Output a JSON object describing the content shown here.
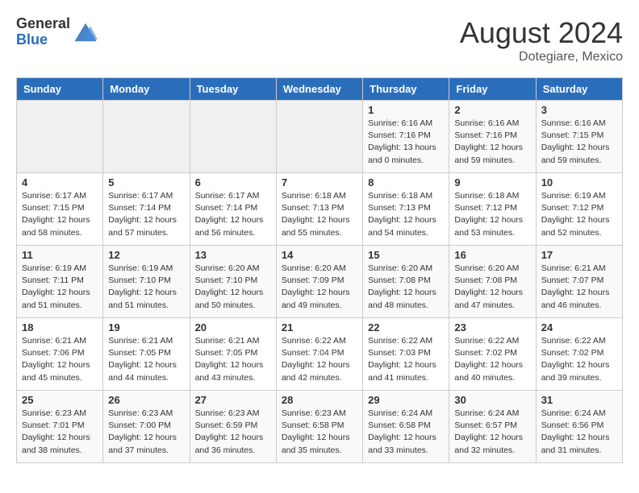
{
  "header": {
    "logo_general": "General",
    "logo_blue": "Blue",
    "month_title": "August 2024",
    "location": "Dotegiare, Mexico"
  },
  "days_of_week": [
    "Sunday",
    "Monday",
    "Tuesday",
    "Wednesday",
    "Thursday",
    "Friday",
    "Saturday"
  ],
  "weeks": [
    [
      {
        "day": "",
        "info": ""
      },
      {
        "day": "",
        "info": ""
      },
      {
        "day": "",
        "info": ""
      },
      {
        "day": "",
        "info": ""
      },
      {
        "day": "1",
        "info": "Sunrise: 6:16 AM\nSunset: 7:16 PM\nDaylight: 13 hours\nand 0 minutes."
      },
      {
        "day": "2",
        "info": "Sunrise: 6:16 AM\nSunset: 7:16 PM\nDaylight: 12 hours\nand 59 minutes."
      },
      {
        "day": "3",
        "info": "Sunrise: 6:16 AM\nSunset: 7:15 PM\nDaylight: 12 hours\nand 59 minutes."
      }
    ],
    [
      {
        "day": "4",
        "info": "Sunrise: 6:17 AM\nSunset: 7:15 PM\nDaylight: 12 hours\nand 58 minutes."
      },
      {
        "day": "5",
        "info": "Sunrise: 6:17 AM\nSunset: 7:14 PM\nDaylight: 12 hours\nand 57 minutes."
      },
      {
        "day": "6",
        "info": "Sunrise: 6:17 AM\nSunset: 7:14 PM\nDaylight: 12 hours\nand 56 minutes."
      },
      {
        "day": "7",
        "info": "Sunrise: 6:18 AM\nSunset: 7:13 PM\nDaylight: 12 hours\nand 55 minutes."
      },
      {
        "day": "8",
        "info": "Sunrise: 6:18 AM\nSunset: 7:13 PM\nDaylight: 12 hours\nand 54 minutes."
      },
      {
        "day": "9",
        "info": "Sunrise: 6:18 AM\nSunset: 7:12 PM\nDaylight: 12 hours\nand 53 minutes."
      },
      {
        "day": "10",
        "info": "Sunrise: 6:19 AM\nSunset: 7:12 PM\nDaylight: 12 hours\nand 52 minutes."
      }
    ],
    [
      {
        "day": "11",
        "info": "Sunrise: 6:19 AM\nSunset: 7:11 PM\nDaylight: 12 hours\nand 51 minutes."
      },
      {
        "day": "12",
        "info": "Sunrise: 6:19 AM\nSunset: 7:10 PM\nDaylight: 12 hours\nand 51 minutes."
      },
      {
        "day": "13",
        "info": "Sunrise: 6:20 AM\nSunset: 7:10 PM\nDaylight: 12 hours\nand 50 minutes."
      },
      {
        "day": "14",
        "info": "Sunrise: 6:20 AM\nSunset: 7:09 PM\nDaylight: 12 hours\nand 49 minutes."
      },
      {
        "day": "15",
        "info": "Sunrise: 6:20 AM\nSunset: 7:08 PM\nDaylight: 12 hours\nand 48 minutes."
      },
      {
        "day": "16",
        "info": "Sunrise: 6:20 AM\nSunset: 7:08 PM\nDaylight: 12 hours\nand 47 minutes."
      },
      {
        "day": "17",
        "info": "Sunrise: 6:21 AM\nSunset: 7:07 PM\nDaylight: 12 hours\nand 46 minutes."
      }
    ],
    [
      {
        "day": "18",
        "info": "Sunrise: 6:21 AM\nSunset: 7:06 PM\nDaylight: 12 hours\nand 45 minutes."
      },
      {
        "day": "19",
        "info": "Sunrise: 6:21 AM\nSunset: 7:05 PM\nDaylight: 12 hours\nand 44 minutes."
      },
      {
        "day": "20",
        "info": "Sunrise: 6:21 AM\nSunset: 7:05 PM\nDaylight: 12 hours\nand 43 minutes."
      },
      {
        "day": "21",
        "info": "Sunrise: 6:22 AM\nSunset: 7:04 PM\nDaylight: 12 hours\nand 42 minutes."
      },
      {
        "day": "22",
        "info": "Sunrise: 6:22 AM\nSunset: 7:03 PM\nDaylight: 12 hours\nand 41 minutes."
      },
      {
        "day": "23",
        "info": "Sunrise: 6:22 AM\nSunset: 7:02 PM\nDaylight: 12 hours\nand 40 minutes."
      },
      {
        "day": "24",
        "info": "Sunrise: 6:22 AM\nSunset: 7:02 PM\nDaylight: 12 hours\nand 39 minutes."
      }
    ],
    [
      {
        "day": "25",
        "info": "Sunrise: 6:23 AM\nSunset: 7:01 PM\nDaylight: 12 hours\nand 38 minutes."
      },
      {
        "day": "26",
        "info": "Sunrise: 6:23 AM\nSunset: 7:00 PM\nDaylight: 12 hours\nand 37 minutes."
      },
      {
        "day": "27",
        "info": "Sunrise: 6:23 AM\nSunset: 6:59 PM\nDaylight: 12 hours\nand 36 minutes."
      },
      {
        "day": "28",
        "info": "Sunrise: 6:23 AM\nSunset: 6:58 PM\nDaylight: 12 hours\nand 35 minutes."
      },
      {
        "day": "29",
        "info": "Sunrise: 6:24 AM\nSunset: 6:58 PM\nDaylight: 12 hours\nand 33 minutes."
      },
      {
        "day": "30",
        "info": "Sunrise: 6:24 AM\nSunset: 6:57 PM\nDaylight: 12 hours\nand 32 minutes."
      },
      {
        "day": "31",
        "info": "Sunrise: 6:24 AM\nSunset: 6:56 PM\nDaylight: 12 hours\nand 31 minutes."
      }
    ]
  ]
}
